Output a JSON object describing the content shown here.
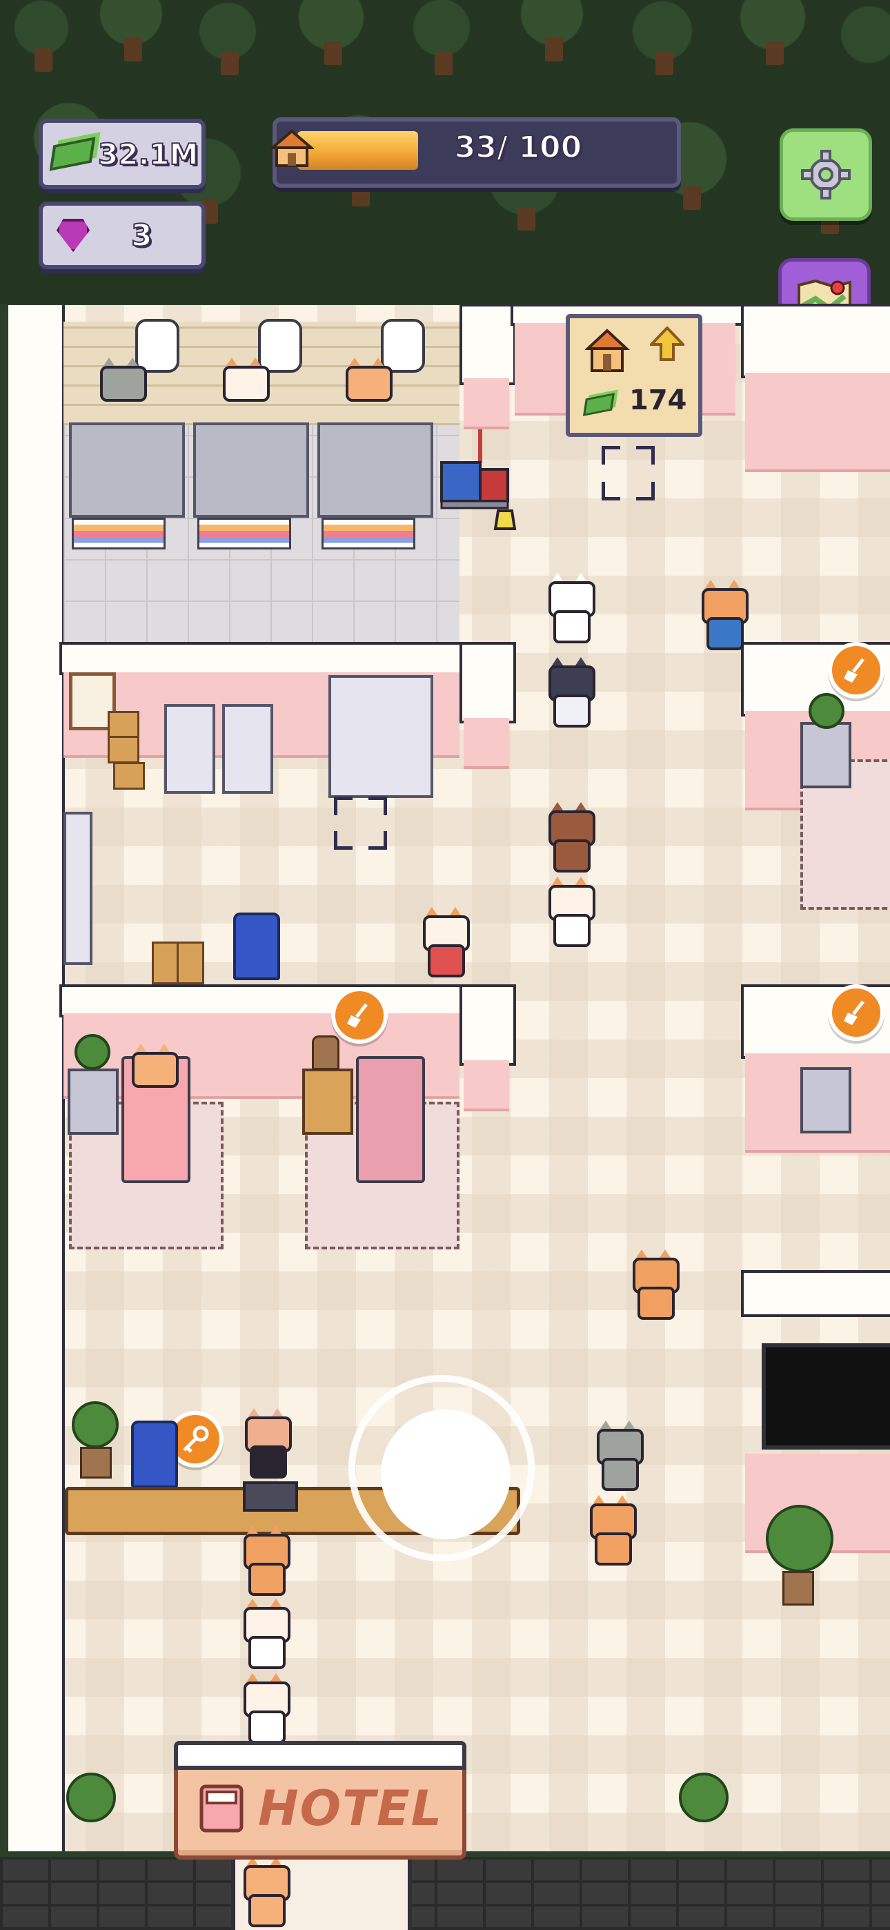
{
  "hud": {
    "cash": "32.1M",
    "gems": "3",
    "level_progress": {
      "label": "33/ 100",
      "current": 33,
      "max": 100
    }
  },
  "upgrade_card": {
    "cost": "174"
  },
  "side_buttons": [
    "settings",
    "map",
    "cat-profile",
    "no-ads"
  ],
  "sign": {
    "text": "HOTEL"
  },
  "colors": {
    "hud_border": "#4a4770",
    "bar_fill": "#f2a533",
    "settings_bg": "#9ee07f",
    "map_bg": "#a05fd6",
    "profile_bg": "#7fd6ef",
    "noads_bg": "#f2d94a",
    "badge": "#f08a24"
  }
}
